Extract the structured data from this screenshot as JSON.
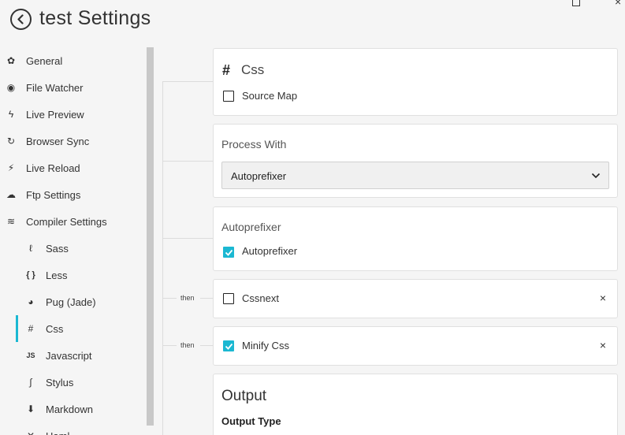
{
  "window": {
    "title": "test Settings",
    "close_glyph": "×"
  },
  "sidebar": {
    "items": [
      {
        "label": "General",
        "icon": "gear-icon",
        "glyph": "✿",
        "level": 0
      },
      {
        "label": "File Watcher",
        "icon": "eye-icon",
        "glyph": "◉",
        "level": 0
      },
      {
        "label": "Live Preview",
        "icon": "bolt-icon",
        "glyph": "ϟ",
        "level": 0
      },
      {
        "label": "Browser Sync",
        "icon": "sync-icon",
        "glyph": "↻",
        "level": 0
      },
      {
        "label": "Live Reload",
        "icon": "magic-wand-icon",
        "glyph": "⚡",
        "level": 0
      },
      {
        "label": "Ftp Settings",
        "icon": "cloud-upload-icon",
        "glyph": "☁",
        "level": 0
      },
      {
        "label": "Compiler Settings",
        "icon": "layers-icon",
        "glyph": "≋",
        "level": 0
      },
      {
        "label": "Sass",
        "icon": "sass-icon",
        "glyph": "ℓ",
        "level": 1
      },
      {
        "label": "Less",
        "icon": "braces-icon",
        "glyph": "{ }",
        "level": 1
      },
      {
        "label": "Pug (Jade)",
        "icon": "pug-icon",
        "glyph": "◕",
        "level": 1
      },
      {
        "label": "Css",
        "icon": "hash-icon",
        "glyph": "#",
        "level": 1,
        "active": true
      },
      {
        "label": "Javascript",
        "icon": "js-icon",
        "glyph": "JS",
        "level": 1
      },
      {
        "label": "Stylus",
        "icon": "stylus-icon",
        "glyph": "∫",
        "level": 1
      },
      {
        "label": "Markdown",
        "icon": "markdown-icon",
        "glyph": "⬇",
        "level": 1
      },
      {
        "label": "Haml",
        "icon": "haml-icon",
        "glyph": "✕",
        "level": 1
      }
    ]
  },
  "css_card": {
    "hash": "#",
    "title": "Css",
    "source_map_label": "Source Map",
    "source_map_checked": false
  },
  "process_card": {
    "heading": "Process With",
    "selected": "Autoprefixer"
  },
  "autoprefixer_card": {
    "heading": "Autoprefixer",
    "checkbox_label": "Autoprefixer",
    "checked": true
  },
  "chain": [
    {
      "then_label": "then",
      "label": "Cssnext",
      "checked": false,
      "close": "×"
    },
    {
      "then_label": "then",
      "label": "Minify Css",
      "checked": true,
      "close": "×"
    }
  ],
  "output_card": {
    "title": "Output",
    "output_type_label": "Output Type"
  },
  "colors": {
    "accent": "#1bb8d2",
    "background": "#f5f5f5",
    "card": "#ffffff"
  }
}
